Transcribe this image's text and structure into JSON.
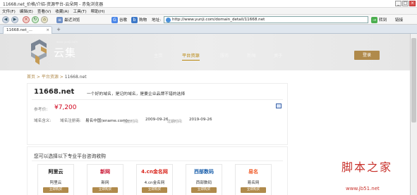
{
  "window": {
    "title": "11668.net_价格/介绍-资源平台-云朵网 - 赤兔浏览器"
  },
  "menu": [
    "文件(F)",
    "编辑(E)",
    "查看(V)",
    "收藏(A)",
    "工具(T)",
    "帮助(H)"
  ],
  "toolbar": {
    "recent": "最近浏览",
    "search": "谷歌",
    "shop": "购物",
    "address_label": "地址:",
    "url": "http://www.yunji.com/domain_detail/11668.net",
    "go": "转到",
    "links": "链接"
  },
  "tab": {
    "label": "11668.net_..."
  },
  "site": {
    "logo_text": "云集",
    "nav": [
      "主页",
      "平台资源",
      "服务",
      "新闻",
      "关于"
    ],
    "nav_active": "平台资源",
    "login": "登录"
  },
  "breadcrumb": {
    "home": "首页",
    "sep": " > ",
    "section": "平台资源",
    "current": "11668.net"
  },
  "domain": {
    "name": "11668.net",
    "slogan": "一个好的域名，是记的域名，是要企业品牌不错的选择",
    "price_label": "参考价:",
    "price": "¥7,200",
    "meaning_label": "域名含义:",
    "registrar_label": "域名注册商:",
    "registrar": "易名中国(ename.com)",
    "reg_time_label": "注册时间:",
    "reg_time": "2009-09-26",
    "exp_time_label": "过期时间:",
    "exp_time": "2019-09-26"
  },
  "consult": {
    "title": "您可以选择以下专业平台咨询收购",
    "registrars": [
      {
        "name": "阿里云",
        "logo": "阿里云",
        "buy": "立即购买",
        "color": "#111111"
      },
      {
        "name": "新网",
        "logo": "新网",
        "buy": "立即购买",
        "color": "#c8102e"
      },
      {
        "name": "4.cn金名网",
        "logo": "4.cn金名网",
        "buy": "立即购买",
        "color": "#d9251c"
      },
      {
        "name": "西部数码",
        "logo": "西部数码",
        "buy": "立即购买",
        "color": "#1a5fab"
      },
      {
        "name": "易名网",
        "logo": "易名",
        "buy": "立即购买",
        "color": "#f05a28"
      }
    ]
  },
  "watermark": {
    "text": "脚本之家",
    "url": "www.jb51.net"
  }
}
